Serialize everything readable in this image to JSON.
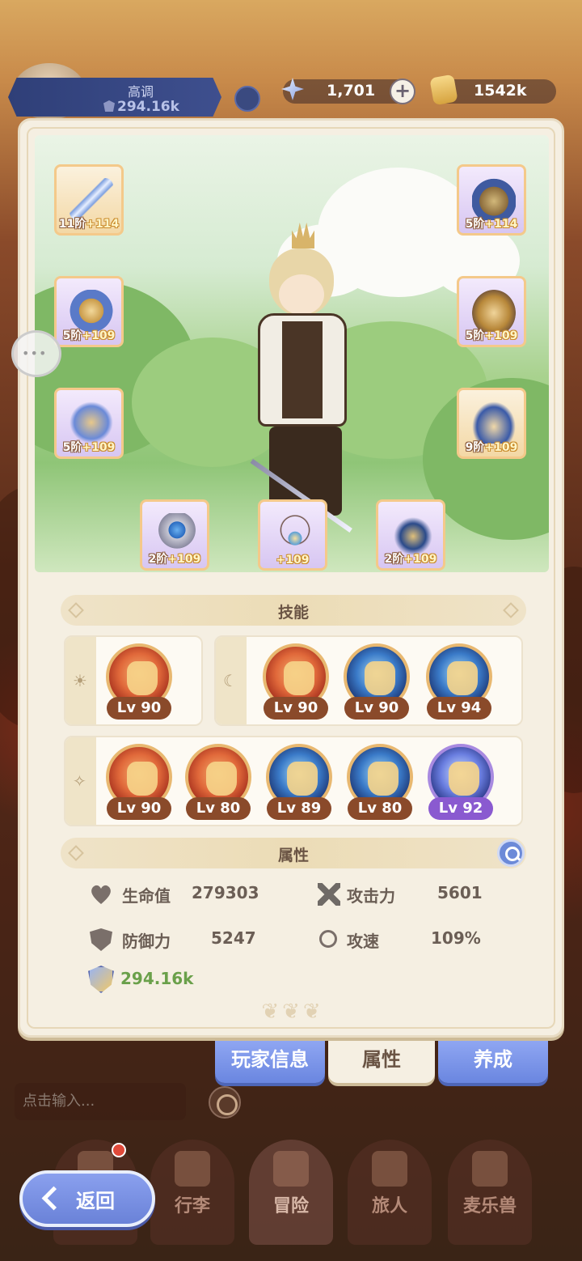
{
  "player": {
    "name": "高调",
    "power": "294.16k"
  },
  "currency": {
    "gems": "1,701",
    "gold": "1542k"
  },
  "equipment": {
    "weapon": {
      "tier": "11阶",
      "plus": "+114"
    },
    "helmet": {
      "tier": "5阶",
      "plus": "+114"
    },
    "armor": {
      "tier": "5阶",
      "plus": "+109"
    },
    "gloves": {
      "tier": "5阶",
      "plus": "+109"
    },
    "pants": {
      "tier": "5阶",
      "plus": "+109"
    },
    "boots": {
      "tier": "9阶",
      "plus": "+109"
    },
    "ring": {
      "tier": "2阶",
      "plus": "+109"
    },
    "necklace": {
      "tier": "",
      "plus": "+109"
    },
    "charm": {
      "tier": "2阶",
      "plus": "+109"
    }
  },
  "skills": {
    "header": "技能",
    "day": [
      "Lv 90"
    ],
    "night": [
      "Lv 90",
      "Lv 90",
      "Lv 94"
    ],
    "star": [
      "Lv 90",
      "Lv 80",
      "Lv 89",
      "Lv 80",
      "Lv 92"
    ]
  },
  "attributes": {
    "header": "属性",
    "hp_label": "生命值",
    "hp_value": "279303",
    "atk_label": "攻击力",
    "atk_value": "5601",
    "def_label": "防御力",
    "def_value": "5247",
    "spd_label": "攻速",
    "spd_value": "109%",
    "power_value": "294.16k"
  },
  "tabs": {
    "player_info": "玩家信息",
    "attributes": "属性",
    "cultivate": "养成"
  },
  "chat": {
    "placeholder": "点击输入..."
  },
  "nav": {
    "bag": "行李",
    "adventure": "冒险",
    "traveler": "旅人",
    "pet": "麦乐兽"
  },
  "back_label": "返回",
  "colors": {
    "accent_blue": "#6a86e0",
    "panel_bg": "#f5efe2",
    "power_green": "#6aa04a",
    "skill_purple": "#8a5ad0"
  }
}
